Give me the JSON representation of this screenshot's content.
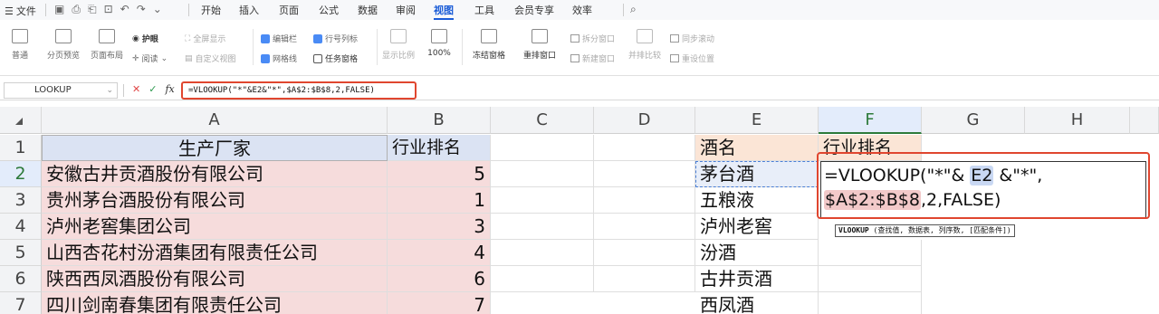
{
  "menubar": {
    "file_label": "文件",
    "tabs": [
      "开始",
      "插入",
      "页面",
      "公式",
      "数据",
      "审阅",
      "视图",
      "工具",
      "会员专享",
      "效率"
    ],
    "active_tab": "视图"
  },
  "ribbon": {
    "normal": "普通",
    "page_break_preview": "分页预览",
    "page_layout": "页面布局",
    "eye_protection": "护眼",
    "reading": "阅读",
    "full_screen": "全屏显示",
    "custom_view": "自定义视图",
    "edit_bar": "编辑栏",
    "row_col_header": "行号列标",
    "gridlines": "网格线",
    "task_pane": "任务窗格",
    "zoom_ratio": "显示比例",
    "zoom_100": "100%",
    "freeze_panes": "冻结窗格",
    "rearrange_windows": "重排窗口",
    "split_window": "拆分窗口",
    "new_window": "新建窗口",
    "side_by_side": "并排比较",
    "sync_scroll": "同步滚动",
    "reset_position": "重设位置"
  },
  "formula_bar": {
    "name_box": "LOOKUP",
    "formula": "=VLOOKUP(\"*\"&E2&\"*\",$A$2:$B$8,2,FALSE)"
  },
  "columns": [
    "A",
    "B",
    "C",
    "D",
    "E",
    "F",
    "G",
    "H"
  ],
  "rows": [
    "1",
    "2",
    "3",
    "4",
    "5",
    "6",
    "7"
  ],
  "table_left": {
    "header_a": "生产厂家",
    "header_b": "行业排名",
    "rows": [
      {
        "a": "安徽古井贡酒股份有限公司",
        "b": "5"
      },
      {
        "a": "贵州茅台酒股份有限公司",
        "b": "1"
      },
      {
        "a": "泸州老窖集团公司",
        "b": "3"
      },
      {
        "a": "山西杏花村汾酒集团有限责任公司",
        "b": "4"
      },
      {
        "a": "陕西西凤酒股份有限公司",
        "b": "6"
      },
      {
        "a": "四川剑南春集团有限责任公司",
        "b": "7"
      }
    ]
  },
  "table_right": {
    "header_e": "酒名",
    "header_f": "行业排名",
    "names": [
      "茅台酒",
      "五粮液",
      "泸州老窖",
      "汾酒",
      "古井贡酒",
      "西凤酒"
    ]
  },
  "editor": {
    "part1": "=VLOOKUP(\"*\"& ",
    "ref1": "E2",
    "part2": " &\"*\", ",
    "ref2": "$A$2:$B$8",
    "part3": ",2,FALSE)"
  },
  "tooltip": {
    "fn": "VLOOKUP",
    "args": " (查找值, 数据表, 列序数, [匹配条件])"
  },
  "colors": {
    "accent": "#1a5cd7",
    "highlight_red": "#e0462f",
    "pink_fill": "#f6dcdc",
    "blue_fill": "#dbe3f3"
  }
}
